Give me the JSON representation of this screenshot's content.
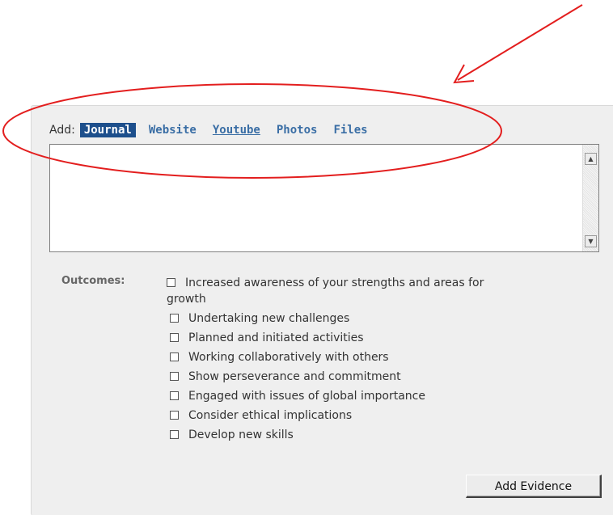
{
  "add_label": "Add:",
  "tabs": [
    {
      "label": "Journal",
      "active": true
    },
    {
      "label": "Website",
      "active": false
    },
    {
      "label": "Youtube",
      "active": false,
      "underlined": true
    },
    {
      "label": "Photos",
      "active": false
    },
    {
      "label": "Files",
      "active": false
    }
  ],
  "journal_text": "",
  "outcomes": {
    "label": "Outcomes:",
    "items": [
      {
        "label_line1": "Increased awareness of your strengths and areas for",
        "label_line2": "growth",
        "checked": false
      },
      {
        "label": "Undertaking new challenges",
        "checked": false
      },
      {
        "label": "Planned and initiated activities",
        "checked": false
      },
      {
        "label": "Working collaboratively with others",
        "checked": false
      },
      {
        "label": "Show perseverance and commitment",
        "checked": false
      },
      {
        "label": "Engaged with issues of global importance",
        "checked": false
      },
      {
        "label": "Consider ethical implications",
        "checked": false
      },
      {
        "label": "Develop new skills",
        "checked": false
      }
    ]
  },
  "add_evidence_button": "Add Evidence",
  "colors": {
    "annotation": "#e31e1e",
    "active_tab_bg": "#1d4f8c",
    "tab_link": "#3a6ea5",
    "panel_bg": "#efefef"
  },
  "icons": {
    "scroll_up": "triangle-up",
    "scroll_down": "triangle-down"
  }
}
